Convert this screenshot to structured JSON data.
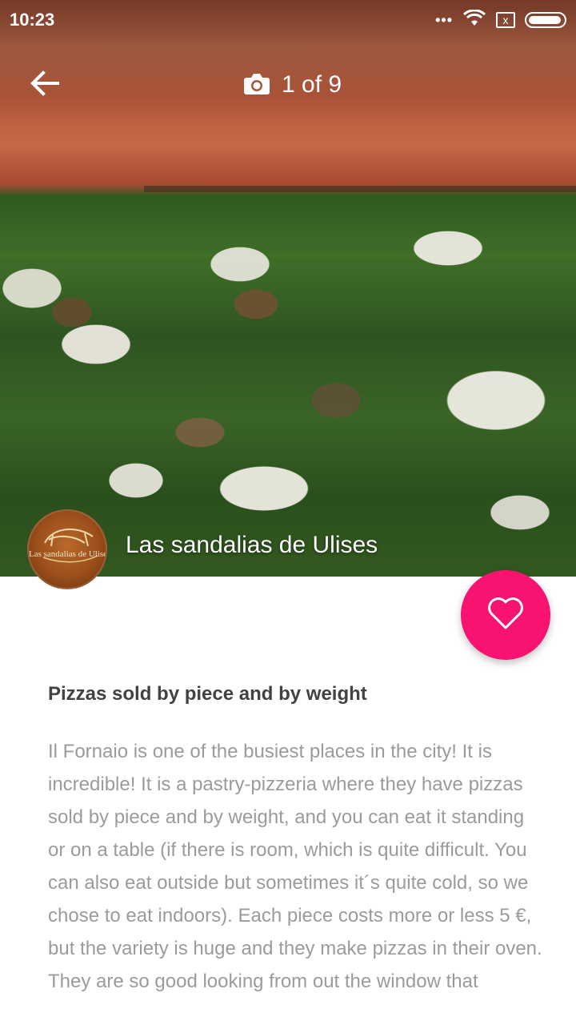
{
  "status_bar": {
    "time": "10:23",
    "more": "•••",
    "sim": "x"
  },
  "toolbar": {
    "photo_counter": "1 of 9"
  },
  "restaurant": {
    "name": "Las sandalias de Ulises",
    "logo_text": "Las sandalias de Ulises"
  },
  "article": {
    "headline": "Pizzas sold by piece and by weight",
    "body": "Il Fornaio is one of the busiest places in the city! It is incredible! It is a pastry-pizzeria where they have pizzas sold by piece and by weight, and you can eat it standing or on a table (if there is room, which is quite difficult. You can also eat outside but sometimes it´s quite cold, so we chose to eat indoors). Each piece costs more or less 5 €, but the variety is huge and they make pizzas in their oven. They are so good looking from out the window that"
  },
  "colors": {
    "accent": "#f7136f",
    "headline": "#424242",
    "body": "#9b9b9b"
  },
  "icons": {
    "back": "arrow-left-icon",
    "camera": "camera-icon",
    "favorite": "heart-outline-icon",
    "wifi": "wifi-icon",
    "battery": "battery-icon"
  }
}
